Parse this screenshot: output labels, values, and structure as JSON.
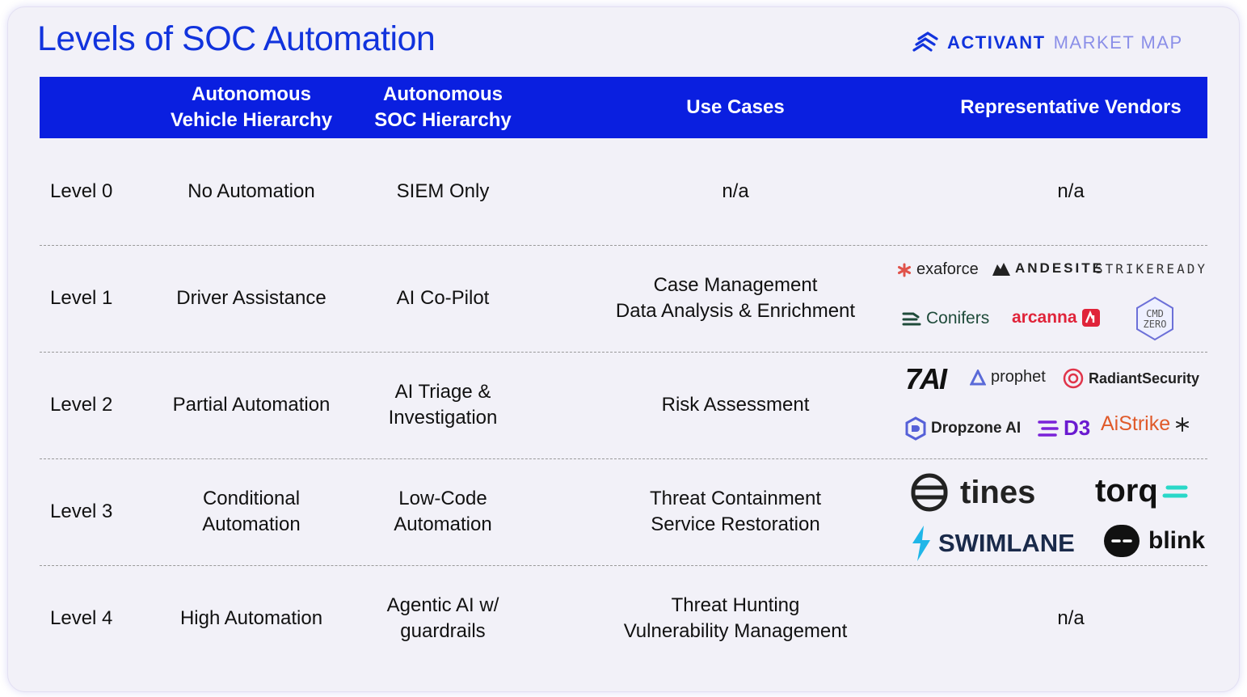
{
  "title": "Levels of SOC Automation",
  "brand": {
    "name": "ACTIVANT",
    "suffix": "MARKET MAP",
    "icon": "activant-chevrons-icon",
    "accent": "#1133dd"
  },
  "colors": {
    "header_bg": "#0a1fe0",
    "title": "#1133dd",
    "card_bg": "#f2f1f8"
  },
  "columns": [
    "Autonomous\nVehicle Hierarchy",
    "Autonomous\nSOC Hierarchy",
    "Use Cases",
    "Representative Vendors"
  ],
  "rows": [
    {
      "level": "Level 0",
      "vehicle": "No Automation",
      "soc": "SIEM Only",
      "use_cases": "n/a",
      "vendors_text": "n/a"
    },
    {
      "level": "Level 1",
      "vehicle": "Driver Assistance",
      "soc": "AI Co-Pilot",
      "use_cases": "Case Management\nData Analysis & Enrichment",
      "vendors": [
        "exaforce",
        "ANDESITE",
        "STRIKEREADY",
        "Conifers",
        "arcanna",
        "CMD ZERO"
      ]
    },
    {
      "level": "Level 2",
      "vehicle": "Partial Automation",
      "soc": "AI Triage &\nInvestigation",
      "use_cases": "Risk Assessment",
      "vendors": [
        "7AI",
        "prophet",
        "RadiantSecurity",
        "Dropzone AI",
        "D3",
        "AiStrike"
      ]
    },
    {
      "level": "Level 3",
      "vehicle": "Conditional\nAutomation",
      "soc": "Low-Code\nAutomation",
      "use_cases": "Threat Containment\nService Restoration",
      "vendors": [
        "tines",
        "torq",
        "SWIMLANE",
        "blink"
      ]
    },
    {
      "level": "Level 4",
      "vehicle": "High Automation",
      "soc": "Agentic AI w/\nguardrails",
      "use_cases": "Threat Hunting\nVulnerability Management",
      "vendors_text": "n/a"
    }
  ]
}
